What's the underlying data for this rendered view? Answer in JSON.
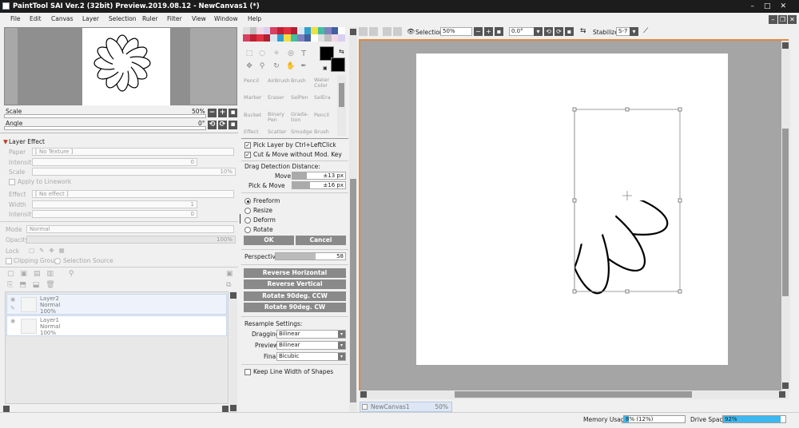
{
  "window": {
    "title": "PaintTool SAI Ver.2 (32bit) Preview.2019.08.12 - NewCanvas1 (*)"
  },
  "menu": {
    "items": [
      "File",
      "Edit",
      "Canvas",
      "Layer",
      "Selection",
      "Ruler",
      "Filter",
      "View",
      "Window",
      "Help"
    ]
  },
  "navigator": {
    "scale_label": "Scale",
    "scale_value": "50%",
    "angle_label": "Angle",
    "angle_value": "0°"
  },
  "layer_effect": {
    "header": "Layer Effect",
    "paper_label": "Paper",
    "paper_value": "[ No Texture ]",
    "intensity_label": "Intensity",
    "intensity_value": "0",
    "scale_label": "Scale",
    "scale_value": "10%",
    "apply_lineart": "Apply to Linework",
    "effect_label": "Effect",
    "effect_value": "[ No effect ]",
    "width_label": "Width",
    "width_value": "1",
    "intensity2_label": "Intensity",
    "intensity2_value": "0"
  },
  "layer_props": {
    "mode_label": "Mode",
    "mode_value": "Normal",
    "opacity_label": "Opacity",
    "opacity_value": "100%",
    "lock_label": "Lock",
    "clipping_label": "Clipping Group",
    "selection_source_label": "Selection Source"
  },
  "layers": [
    {
      "name": "Layer2",
      "mode": "Normal",
      "opacity": "100%"
    },
    {
      "name": "Layer1",
      "mode": "Normal",
      "opacity": "100%"
    }
  ],
  "palette": {
    "swatches": [
      "#e0e0e0",
      "#c0c0c0",
      "#f0d8e8",
      "#d8d0f0",
      "#d84060",
      "#c02030",
      "#e03040",
      "#b02030",
      "#d8e8f0",
      "#30a0d0",
      "#f0e040",
      "#40c0a0",
      "#8080c0",
      "#4060a0",
      "#ffffff"
    ],
    "primary_color": "#000000",
    "secondary_color": "#000000"
  },
  "brushes": {
    "row1": [
      "Pencil",
      "AirBrush",
      "Brush",
      "Water Color"
    ],
    "row2": [
      "Marker",
      "Eraser",
      "SelPen",
      "SelEra"
    ],
    "row3": [
      "Bucket",
      "Binary Pen",
      "Grada-tion",
      "Pencil"
    ],
    "row4": [
      "Effect",
      "Scatter",
      "Smudge",
      "Brush"
    ]
  },
  "move_tool": {
    "pick_layer": "Pick Layer by Ctrl+LeftClick",
    "cut_move": "Cut & Move without Mod. Key",
    "drag_label": "Drag Detection Distance:",
    "move_label": "Move",
    "move_value": "±13 px",
    "pick_move_label": "Pick & Move",
    "pick_move_value": "±16 px"
  },
  "transform": {
    "modes": [
      "Freeform",
      "Resize",
      "Deform",
      "Rotate"
    ],
    "ok_label": "OK",
    "cancel_label": "Cancel",
    "perspective_label": "Perspective",
    "perspective_value": "58",
    "reverse_h": "Reverse Horizontal",
    "reverse_v": "Reverse Vertical",
    "rotate_ccw": "Rotate 90deg. CCW",
    "rotate_cw": "Rotate 90deg. CW",
    "resample_label": "Resample Settings:",
    "dragging_label": "Dragging",
    "dragging_value": "Bilinear",
    "preview_label": "Preview",
    "preview_value": "Bilinear",
    "final_label": "Final",
    "final_value": "Bicubic",
    "keep_line_width": "Keep Line Width of Shapes"
  },
  "canvas_toolbar": {
    "selection_label": "Selection",
    "zoom_value": "50%",
    "angle_value": "0.0°",
    "stabilizer_label": "Stabilizer",
    "stabilizer_value": "S-7"
  },
  "status": {
    "tab_name": "NewCanvas1",
    "tab_zoom": "50%",
    "memory_label": "Memory Usage",
    "memory_value": "8% (12%)",
    "memory_fraction": 0.08,
    "drive_label": "Drive Space",
    "drive_value": "92%",
    "drive_fraction": 0.92
  }
}
